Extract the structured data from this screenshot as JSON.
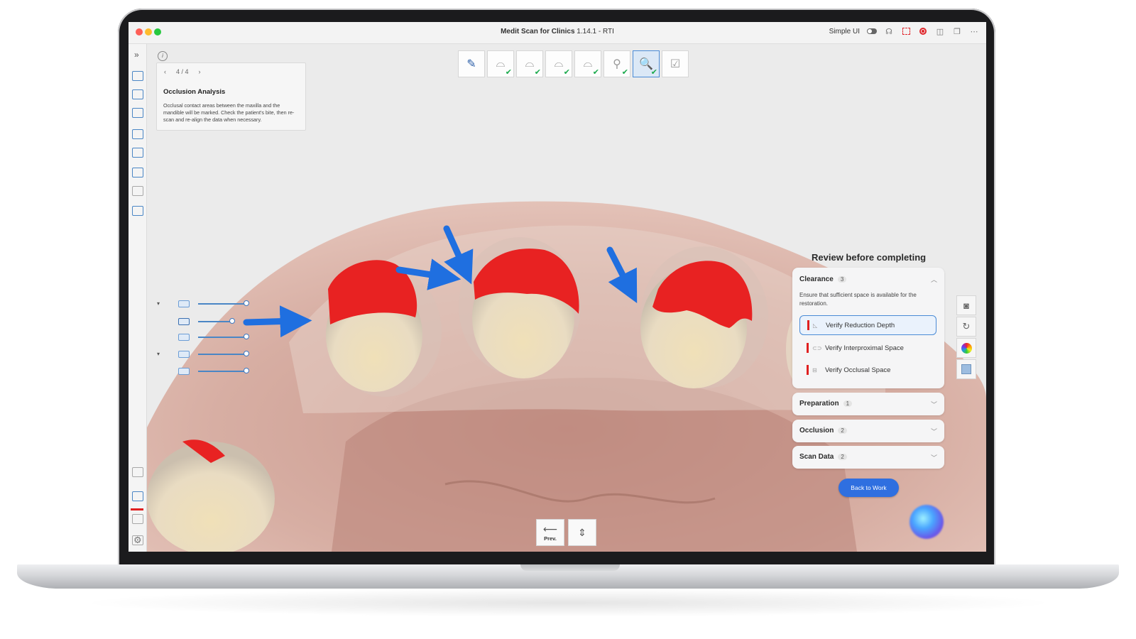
{
  "window": {
    "title_bold": "Medit Scan for Clinics",
    "title_rest": " 1.14.1 - RTI",
    "simple_ui_label": "Simple UI"
  },
  "info_panel": {
    "pager": "4 / 4",
    "prev_glyph": "‹",
    "next_glyph": "›",
    "title": "Occlusion Analysis",
    "description": "Occlusal contact areas between the maxilla and the mandible will be marked. Check the patient's bite, then re-scan and re-align the data when necessary."
  },
  "steps": [
    {
      "icon": "notes-icon",
      "glyph": "✎",
      "checked": false,
      "active": false
    },
    {
      "icon": "maxilla-prep-icon",
      "glyph": "⌓",
      "checked": true,
      "active": false
    },
    {
      "icon": "maxilla-icon",
      "glyph": "⌓",
      "checked": true,
      "active": false
    },
    {
      "icon": "mandible-icon",
      "glyph": "⌓",
      "checked": true,
      "active": false
    },
    {
      "icon": "bite-icon",
      "glyph": "⌓",
      "checked": true,
      "active": false
    },
    {
      "icon": "scanbody-icon",
      "glyph": "⚲",
      "checked": true,
      "active": false
    },
    {
      "icon": "occlusion-analysis-icon",
      "glyph": "🔍",
      "checked": true,
      "active": true
    },
    {
      "icon": "complete-icon",
      "glyph": "☑",
      "checked": false,
      "active": false
    }
  ],
  "review": {
    "title": "Review before completing",
    "clearance": {
      "label": "Clearance",
      "count": "3",
      "description": "Ensure that sufficient space is available for the restoration.",
      "items": [
        {
          "label": "Verify Reduction Depth"
        },
        {
          "label": "Verify Interproximal Space"
        },
        {
          "label": "Verify Occlusal Space"
        }
      ]
    },
    "sections": [
      {
        "label": "Preparation",
        "count": "1"
      },
      {
        "label": "Occlusion",
        "count": "2"
      },
      {
        "label": "Scan Data",
        "count": "2"
      }
    ],
    "back_button": "Back to Work"
  },
  "bottom": {
    "prev_label": "Prev."
  },
  "colors": {
    "accent": "#2f6fe0",
    "contact_red": "#e82222",
    "arrow_blue": "#1f6fe0"
  }
}
